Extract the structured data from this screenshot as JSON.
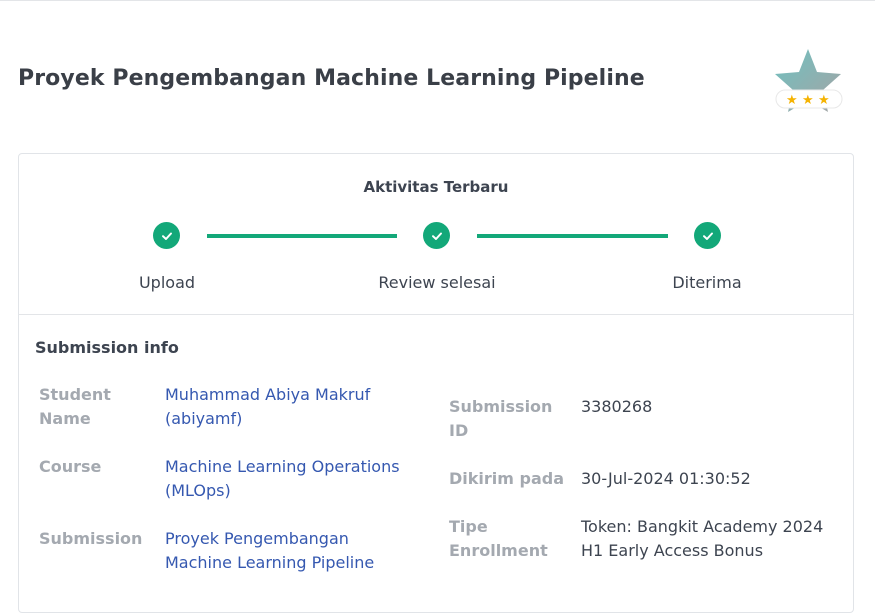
{
  "page": {
    "title": "Proyek Pengembangan Machine Learning Pipeline"
  },
  "badge": {
    "icon": "star-rating-badge-icon",
    "stars": 3,
    "colors": {
      "star": "#7fb6b3",
      "ribbon_star": "#f5b301"
    }
  },
  "activity": {
    "title": "Aktivitas Terbaru",
    "steps": [
      {
        "label": "Upload"
      },
      {
        "label": "Review selesai"
      },
      {
        "label": "Diterima"
      }
    ],
    "accent_color": "#13a879"
  },
  "submission_info": {
    "title": "Submission info",
    "student_name": {
      "label": "Student Name",
      "value": "Muhammad Abiya Makruf (abiyamf)"
    },
    "course": {
      "label": "Course",
      "value": "Machine Learning Operations (MLOps)"
    },
    "submission": {
      "label": "Submission",
      "value": "Proyek Pengembangan Machine Learning Pipeline"
    },
    "submission_id": {
      "label": "Submission ID",
      "value": "3380268"
    },
    "sent_at": {
      "label": "Dikirim pada",
      "value": "30-Jul-2024 01:30:52"
    },
    "enrollment_type": {
      "label": "Tipe Enrollment",
      "value": "Token: Bangkit Academy 2024 H1 Early Access Bonus"
    }
  }
}
